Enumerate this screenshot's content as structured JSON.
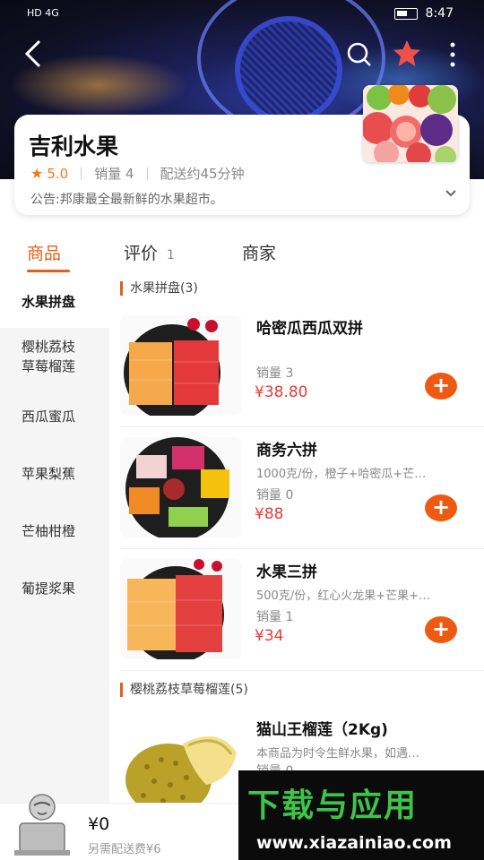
{
  "status_bar": {
    "left": "HD 4G",
    "time": "8:47"
  },
  "shop": {
    "name": "吉利水果",
    "rating": "5.0",
    "sales": "销量 4",
    "delivery": "配送约45分钟",
    "notice": "公告:邦康最全最新鲜的水果超市。"
  },
  "tabs": [
    {
      "label": "商品"
    },
    {
      "label": "评价",
      "count": "1"
    },
    {
      "label": "商家"
    }
  ],
  "categories": [
    "水果拼盘",
    "樱桃荔枝\n草莓榴莲",
    "西瓜蜜瓜",
    "苹果梨蕉",
    "芒柚柑橙",
    "葡提浆果"
  ],
  "sections": [
    {
      "title": "水果拼盘(3)"
    },
    {
      "title": "樱桃荔枝草莓榴莲(5)"
    }
  ],
  "products": [
    {
      "name": "哈密瓜西瓜双拼",
      "desc": "",
      "sales": "销量 3",
      "price": "¥38.80"
    },
    {
      "name": "商务六拼",
      "desc": "1000克/份，橙子+哈密瓜+芒…",
      "sales": "销量 0",
      "price": "¥88"
    },
    {
      "name": "水果三拼",
      "desc": "500克/份，红心火龙果+芒果+…",
      "sales": "销量 1",
      "price": "¥34"
    },
    {
      "name": "猫山王榴莲（2Kg)",
      "desc": "本商品为时令生鲜水果，如遇…",
      "sales": "销量 0",
      "price": ""
    }
  ],
  "cart": {
    "total": "¥0",
    "fee": "另需配送费¥6"
  },
  "watermark": {
    "title": "下载与应用",
    "url": "www.xiazainiao.com"
  },
  "colors": {
    "accent": "#e0601a",
    "price": "#e83a3a",
    "add_button": "#ee5a12"
  }
}
